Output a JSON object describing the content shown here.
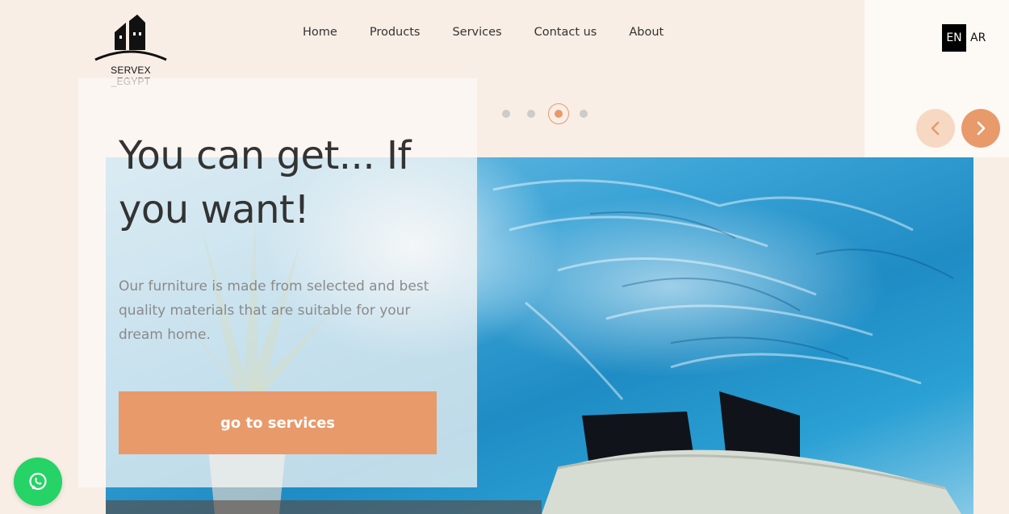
{
  "brand": {
    "name": "SERVEX _EGYPT"
  },
  "nav": {
    "items": [
      {
        "label": "Home"
      },
      {
        "label": "Products"
      },
      {
        "label": "Services"
      },
      {
        "label": "Contact us"
      },
      {
        "label": "About"
      }
    ]
  },
  "language": {
    "current": "EN",
    "other": "AR"
  },
  "slider": {
    "slide_count": 4,
    "active_slide": 3
  },
  "hero": {
    "title": "You can get... If you want!",
    "description": "Our furniture is made from selected and best quality materials that are suitable for your dream home.",
    "cta_label": "go to services"
  },
  "colors": {
    "accent": "#e89a6b",
    "accent_light": "#f6d8c3",
    "background": "#f8eee5",
    "whatsapp": "#25d366"
  },
  "icons": {
    "prev": "chevron-left-icon",
    "next": "chevron-right-icon",
    "chat": "whatsapp-icon",
    "logo": "building-logo-icon"
  }
}
